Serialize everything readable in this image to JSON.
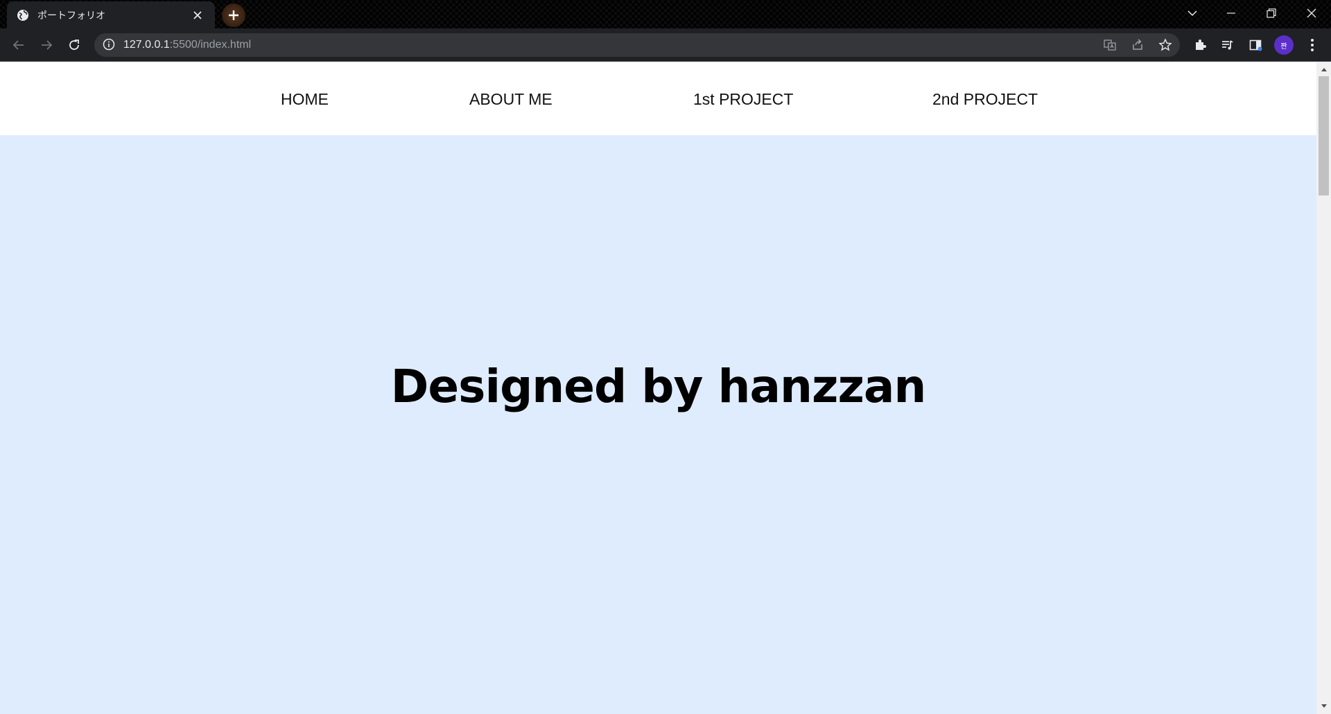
{
  "browser": {
    "tab": {
      "title": "ポートフォリオ",
      "favicon": "globe-icon"
    },
    "address": {
      "host": "127.0.0.1",
      "path": ":5500/index.html"
    },
    "profile_initial": "짠",
    "colors": {
      "chrome_bg": "#202124",
      "omnibox_bg": "#35363a",
      "avatar": "#5b2fc9"
    }
  },
  "site": {
    "nav": [
      {
        "label": "HOME"
      },
      {
        "label": "ABOUT ME"
      },
      {
        "label": "1st PROJECT"
      },
      {
        "label": "2nd PROJECT"
      }
    ],
    "hero": {
      "title": "Designed by hanzzan"
    },
    "colors": {
      "page_bg": "#dfecfd",
      "nav_bg": "#ffffff",
      "text": "#000000"
    }
  }
}
